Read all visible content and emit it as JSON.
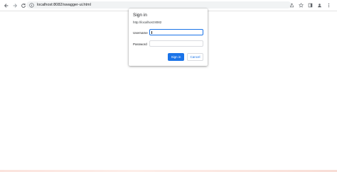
{
  "browser": {
    "url": "localhost:8082/swagger-ui.html",
    "icons": {
      "back": "arrow-left-icon",
      "forward": "arrow-right-icon",
      "reload": "reload-icon",
      "site_info": "info-icon",
      "share": "share-icon",
      "bookmark": "star-icon",
      "side_panel": "side-panel-icon",
      "profile": "profile-icon",
      "menu": "kebab-menu-icon"
    }
  },
  "dialog": {
    "title": "Sign in",
    "origin": "http://localhost:8082",
    "username_label": "Username",
    "username_value": "",
    "password_label": "Password",
    "password_value": "",
    "sign_in_label": "Sign in",
    "cancel_label": "Cancel"
  },
  "colors": {
    "accent": "#1a73e8",
    "toolbar_bg": "#ffffff",
    "omnibox_bg": "#f1f3f4"
  }
}
